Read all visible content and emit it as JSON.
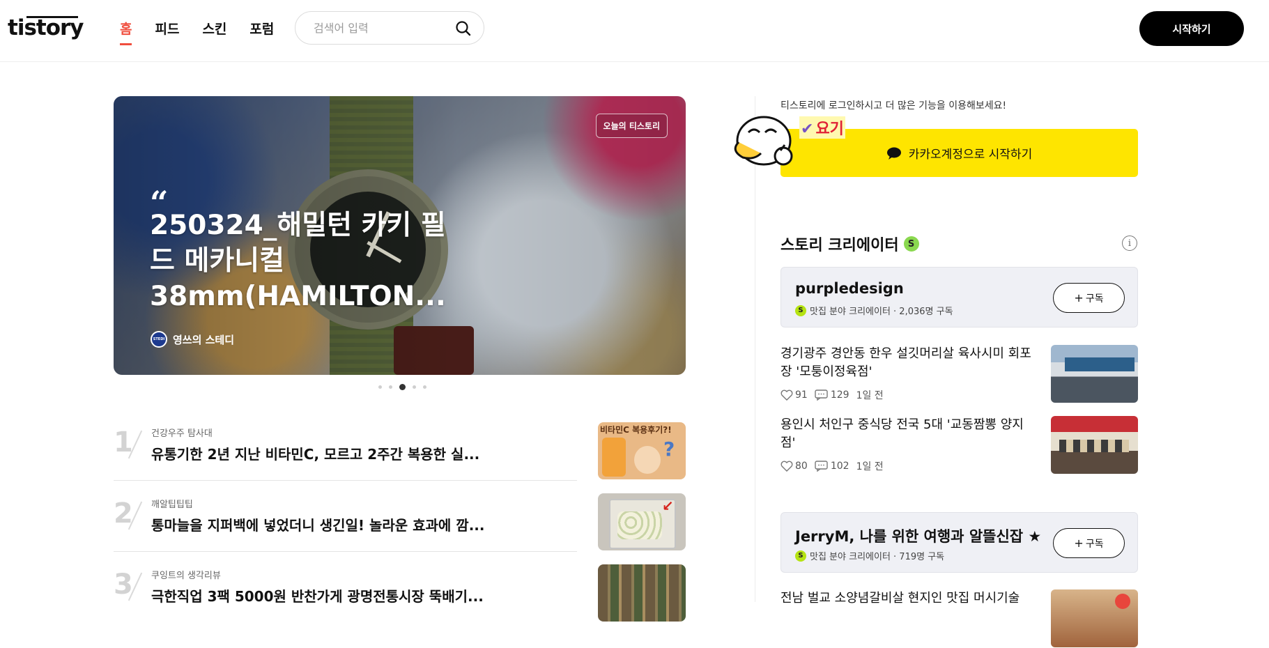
{
  "header": {
    "logo": "tistory",
    "nav": [
      {
        "label": "홈",
        "active": true
      },
      {
        "label": "피드",
        "active": false
      },
      {
        "label": "스킨",
        "active": false
      },
      {
        "label": "포럼",
        "active": false
      }
    ],
    "search_placeholder": "검색어 입력",
    "start_button": "시작하기"
  },
  "hero": {
    "badge": "오늘의 티스토리",
    "quote": "“",
    "title": "250324_해밀턴 카키 필드 메카니컬 38mm(HAMILTON...",
    "author": "영쓰의 스테디",
    "author_avatar_text": "STEDI",
    "pagination": {
      "count": 5,
      "active_index": 2
    }
  },
  "ranking": [
    {
      "rank": "1",
      "category": "건강우주 탐사대",
      "title": "유통기한 2년 지난 비타민C, 모르고 2주간 복용한 실...",
      "thumb_text": "비타민C 복용후기?!",
      "thumb_color": "#e9b986"
    },
    {
      "rank": "2",
      "category": "깨알팁팁팁",
      "title": "통마늘을 지퍼백에 넣었더니 생긴일! 놀라운 효과에 깜...",
      "thumb_color": "#c9c5bd"
    },
    {
      "rank": "3",
      "category": "쿠잉트의 생각리뷰",
      "title": "극한직업 3팩 5000원 반찬가게 광명전통시장 뚝배기...",
      "thumb_color": "#6b5a40"
    }
  ],
  "sidebar": {
    "login_prompt": "티스토리에 로그인하시고 더 많은 기능을 이용해보세요!",
    "kakao_button": "카카오계정으로 시작하기",
    "mascot_label": "요기",
    "creator_section_title": "스토리 크리에이터",
    "creator_badge": "S",
    "creators": [
      {
        "name": "purpledesign",
        "meta": "맛집 분야 크리에이터 · 2,036명 구독",
        "subscribe": "구독",
        "posts": [
          {
            "title": "경기광주 경안동 한우 설깃머리살 육사시미 회포장 '모퉁이정육점'",
            "likes": "91",
            "comments": "129",
            "time": "1일 전"
          },
          {
            "title": "용인시 처인구 중식당 전국 5대 '교동짬뽕 양지점'",
            "likes": "80",
            "comments": "102",
            "time": "1일 전"
          }
        ]
      },
      {
        "name": "JerryM, 나를 위한 여행과 알뜰신잡 ★",
        "meta": "맛집 분야 크리에이터 · 719명 구독",
        "subscribe": "구독",
        "posts": [
          {
            "title": "전남 벌교 소양념갈비살 현지인 맛집 머시기술"
          }
        ]
      }
    ]
  },
  "colors": {
    "accent": "#f04e3e",
    "kakao_yellow": "#fee500",
    "creator_badge_green": "#8ad84f",
    "card_bg": "#eff0f5"
  }
}
